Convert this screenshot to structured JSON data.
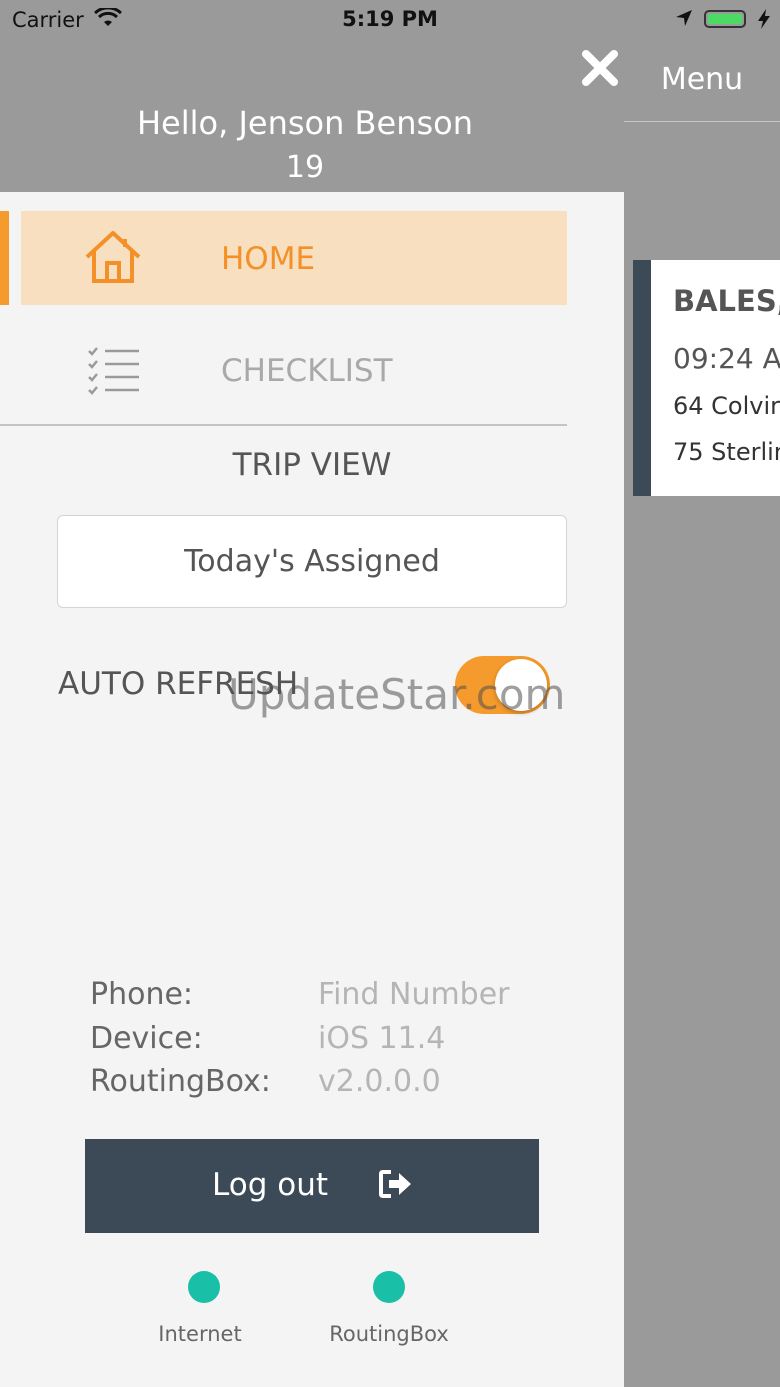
{
  "status_bar": {
    "carrier": "Carrier",
    "time": "5:19 PM",
    "battery_color": "#4cd964"
  },
  "background_screen": {
    "menu_title": "Menu",
    "trip_card": {
      "name": "BALES,",
      "time": "09:24 A",
      "pickup_address": "64 Colvir",
      "dropoff_address": "75 Sterlin"
    }
  },
  "drawer": {
    "greeting": "Hello, Jenson Benson",
    "sub_id": "19",
    "nav": [
      {
        "label": "HOME",
        "icon": "home-icon",
        "active": true
      },
      {
        "label": "CHECKLIST",
        "icon": "checklist-icon",
        "active": false
      }
    ],
    "trip_view": {
      "title": "TRIP VIEW",
      "selected": "Today's Assigned"
    },
    "auto_refresh": {
      "label": "AUTO REFRESH",
      "on": true
    },
    "watermark": "UpdateStar.com",
    "info": [
      {
        "key": "Phone:",
        "value": "Find Number"
      },
      {
        "key": "Device:",
        "value": "iOS 11.4"
      },
      {
        "key": "RoutingBox:",
        "value": "v2.0.0.0"
      }
    ],
    "logout_label": "Log out",
    "connection_status": [
      {
        "label": "Internet",
        "status": "connected"
      },
      {
        "label": "RoutingBox",
        "status": "connected"
      }
    ]
  },
  "colors": {
    "accent": "#f59a2c",
    "active_bg": "#f7dfbf",
    "dark": "#3c4a57",
    "status_ok": "#19bfa7"
  }
}
